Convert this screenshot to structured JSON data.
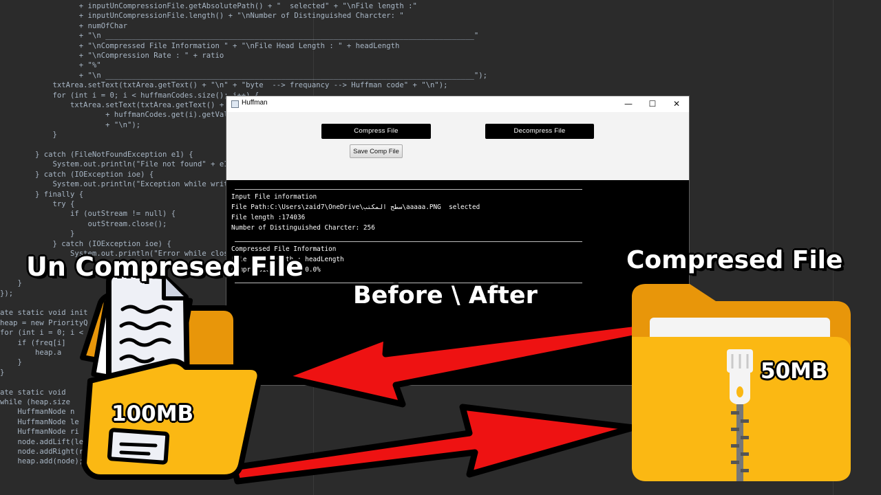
{
  "editor": {
    "lines": [
      "                  + inputUnCompressionFile.getAbsolutePath() + \"  selected\" + \"\\nFile length :\"",
      "                  + inputUnCompressionFile.length() + \"\\nNumber of Distinguished Charcter: \"",
      "                  + numOfChar",
      "                  + \"\\n ____________________________________________________________________________________\"",
      "                  + \"\\nCompressed File Information \" + \"\\nFile Head Length : \" + headLength",
      "                  + \"\\nCompression Rate : \" + ratio",
      "                  + \"%\"",
      "                  + \"\\n ____________________________________________________________________________________\");",
      "            txtArea.setText(txtArea.getText() + \"\\n\" + \"byte  --> frequancy --> Huffman code\" + \"\\n\");",
      "            for (int i = 0; i < huffmanCodes.size(); i++) {",
      "                txtArea.setText(txtArea.getText() +",
      "                        + huffmanCodes.get(i).getVal",
      "                        + \"\\n\");",
      "            }",
      "",
      "        } catch (FileNotFoundException e1) {",
      "            System.out.println(\"File not found\" + e1",
      "        } catch (IOException ioe) {",
      "            System.out.println(\"Exception while writ",
      "        } finally {",
      "            try {",
      "                if (outStream != null) {",
      "                    outStream.close();",
      "                }",
      "            } catch (IOException ioe) {",
      "                System.out.println(\"Error while clos",
      "            }",
      "        }",
      "    }",
      "});",
      "",
      "ate static void init",
      "heap = new PriorityQ",
      "for (int i = 0; i <",
      "    if (freq[i]",
      "        heap.a",
      "    }",
      "}",
      "",
      "ate static void",
      "while (heap.size",
      "    HuffmanNode n",
      "    HuffmanNode le",
      "    HuffmanNode ri",
      "    node.addLift(le",
      "    node.addRight(right);",
      "    heap.add(node);"
    ]
  },
  "window": {
    "title": "Huffman",
    "minimize_glyph": "—",
    "maximize_glyph": "☐",
    "close_glyph": "✕",
    "compress_label": "Compress File",
    "decompress_label": "Decompress File",
    "save_label": "Save Comp File",
    "output": {
      "separator": "____________________________________________________________________________________",
      "input_heading": "Input File information",
      "file_path": "File Path:C:\\Users\\zaid7\\OneDrive\\سطح المكتب\\aaaaa.PNG  selected",
      "file_length": "File length :174036",
      "num_chars": "Number of Distinguished Charcter: 256",
      "compressed_heading": "Compressed File Information",
      "head_length": "File Head Length : headLength",
      "rate": "Compression Rate : 0.0%"
    }
  },
  "overlay": {
    "left_title": "Un Compresed File",
    "right_title": "Compresed File",
    "middle_title": "Before \\ After",
    "left_size": "100MB",
    "right_size": "50MB"
  },
  "colors": {
    "folder_orange": "#fbb813",
    "folder_dark": "#e8960a",
    "arrow_red": "#ee1212",
    "ide_background": "#2b2b2b"
  }
}
